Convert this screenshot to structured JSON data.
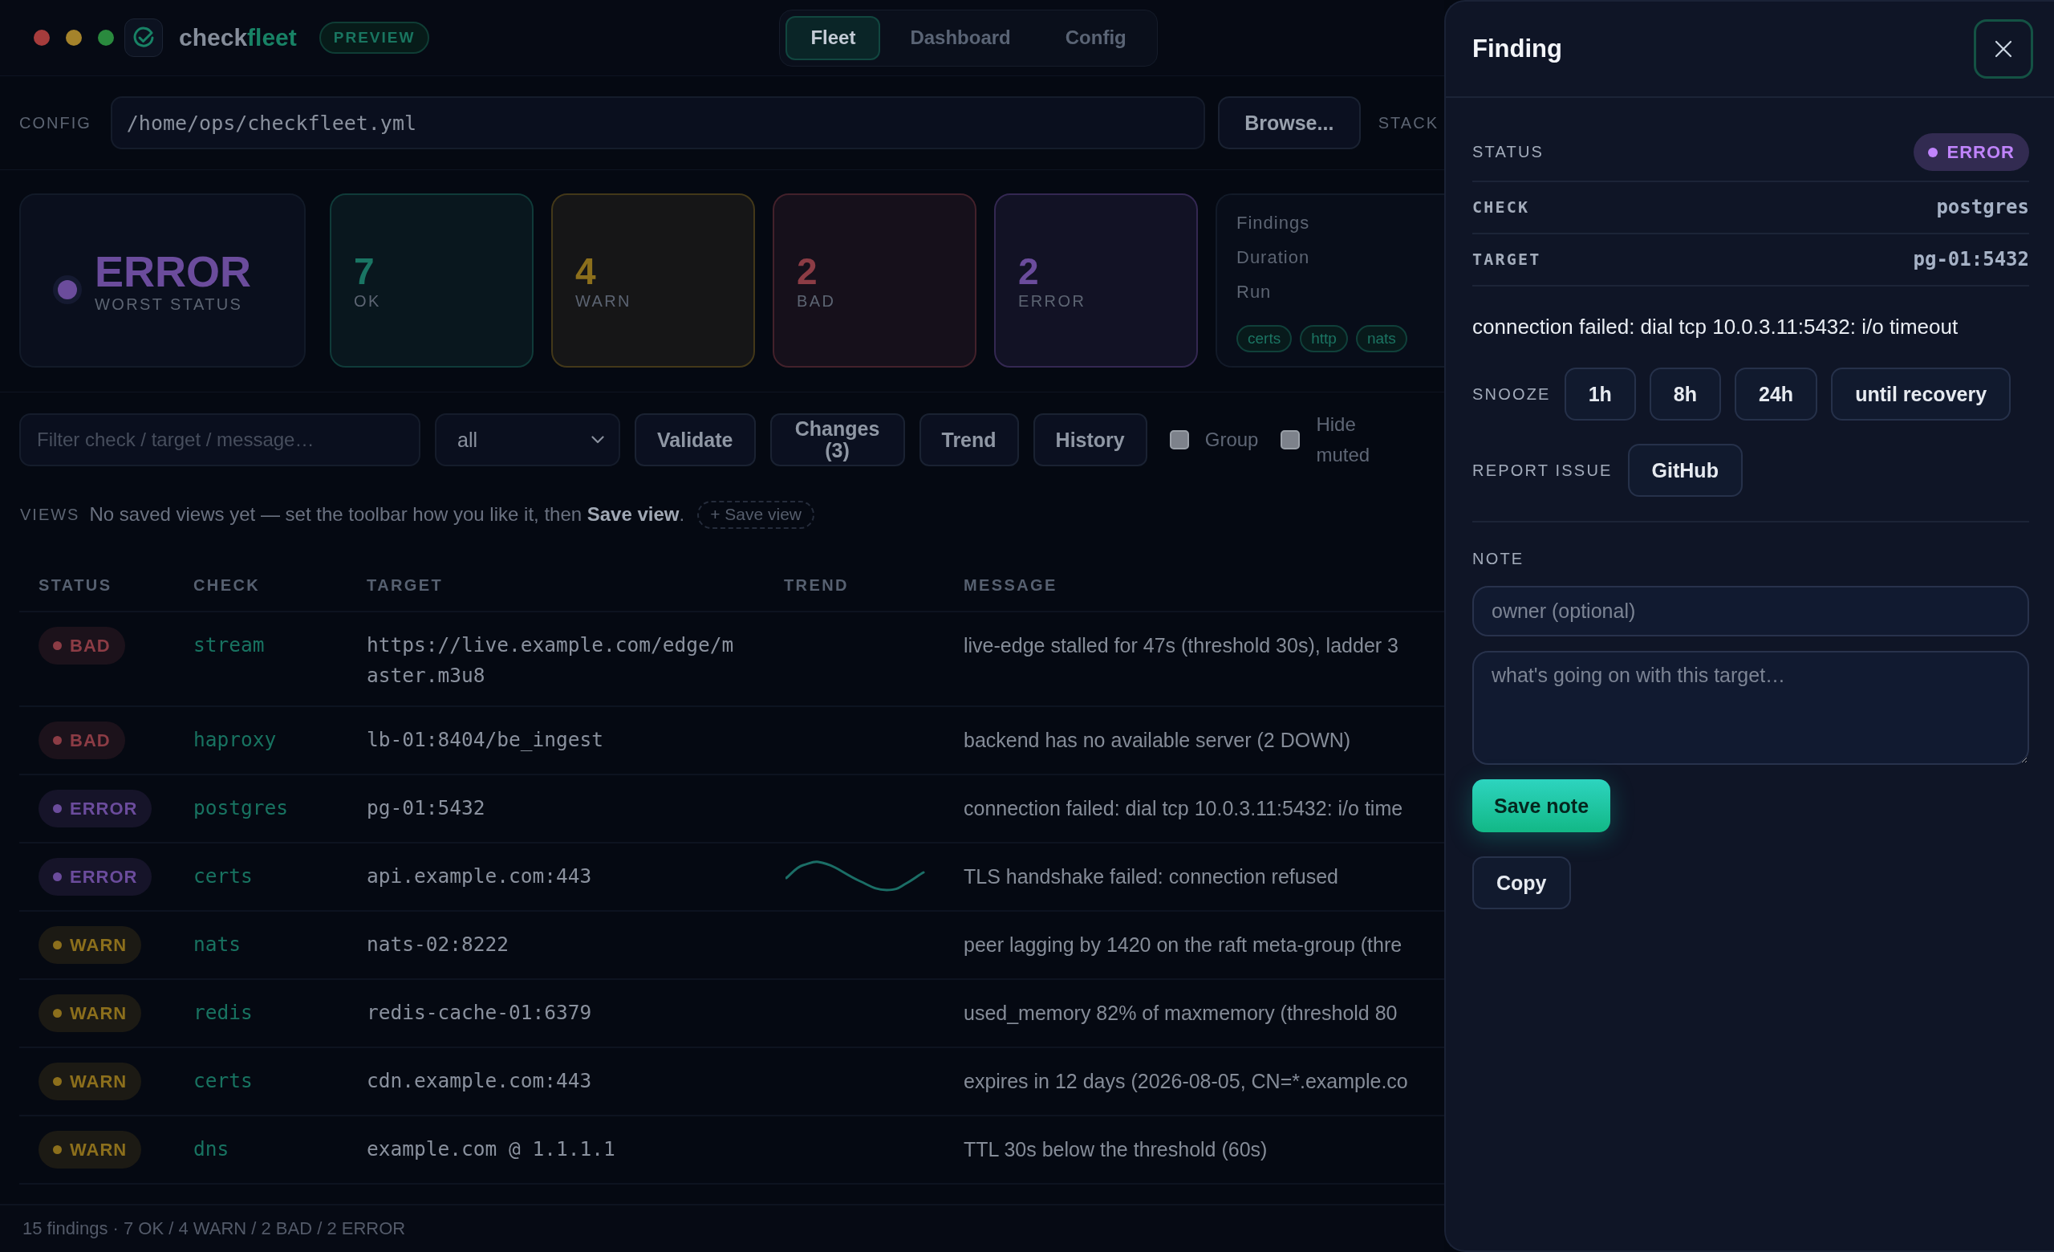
{
  "app": {
    "brand": {
      "name": "check",
      "accent": "fleet"
    },
    "badge": "PREVIEW"
  },
  "tabs": [
    {
      "label": "Fleet",
      "selected": true
    },
    {
      "label": "Dashboard",
      "selected": false
    },
    {
      "label": "Config",
      "selected": false
    }
  ],
  "config": {
    "label": "CONFIG",
    "path": "/home/ops/checkfleet.yml",
    "browse_button": "Browse...",
    "stack_label": "STACK"
  },
  "summary": {
    "worst": {
      "value": "ERROR",
      "label": "WORST STATUS",
      "color": "#6b4c9c"
    },
    "counts": [
      {
        "count": "7",
        "label": "OK",
        "color": "#1a7563"
      },
      {
        "count": "4",
        "label": "WARN",
        "color": "#8c6f1c"
      },
      {
        "count": "2",
        "label": "BAD",
        "color": "#8c3c45"
      },
      {
        "count": "2",
        "label": "ERROR",
        "color": "#6b4c9c"
      }
    ],
    "info": {
      "labels": [
        "Findings",
        "Duration",
        "Run"
      ],
      "tags": [
        "certs",
        "http",
        "nats"
      ]
    }
  },
  "toolbar": {
    "filter": {
      "placeholder": "Filter check / target / message…"
    },
    "status_select": {
      "value": "all"
    },
    "buttons": [
      "Validate",
      "Changes (3)",
      "Trend",
      "History"
    ],
    "checkboxes": [
      {
        "label": "Group",
        "checked": false
      },
      {
        "label": "Hide muted",
        "checked": false
      }
    ]
  },
  "views": {
    "label": "VIEWS",
    "hint": "No saved views yet — set the toolbar how you like it, then **Save view**.",
    "save_button": "+ Save view"
  },
  "table": {
    "columns": [
      "STATUS",
      "CHECK",
      "TARGET",
      "TREND",
      "MESSAGE"
    ],
    "rows": [
      {
        "status": "BAD",
        "color": "#8c3c45",
        "check": "stream",
        "target": "https://live.example.com/edge/master.m3u8",
        "trend": false,
        "message": "live-edge stalled for 47s (threshold 30s), ladder 3"
      },
      {
        "status": "BAD",
        "color": "#8c3c45",
        "check": "haproxy",
        "target": "lb-01:8404/be_ingest",
        "trend": false,
        "message": "backend has no available server (2 DOWN)"
      },
      {
        "status": "ERROR",
        "color": "#6b4c9c",
        "check": "postgres",
        "target": "pg-01:5432",
        "trend": false,
        "message": "connection failed: dial tcp 10.0.3.11:5432: i/o time"
      },
      {
        "status": "ERROR",
        "color": "#6b4c9c",
        "check": "certs",
        "target": "api.example.com:443",
        "trend": true,
        "message": "TLS handshake failed: connection refused"
      },
      {
        "status": "WARN",
        "color": "#8c6f1c",
        "check": "nats",
        "target": "nats-02:8222",
        "trend": false,
        "message": "peer lagging by 1420 on the raft meta-group (thre"
      },
      {
        "status": "WARN",
        "color": "#8c6f1c",
        "check": "redis",
        "target": "redis-cache-01:6379",
        "trend": false,
        "message": "used_memory 82% of maxmemory (threshold 80"
      },
      {
        "status": "WARN",
        "color": "#8c6f1c",
        "check": "certs",
        "target": "cdn.example.com:443",
        "trend": false,
        "message": "expires in 12 days (2026-08-05, CN=*.example.co"
      },
      {
        "status": "WARN",
        "color": "#8c6f1c",
        "check": "dns",
        "target": "example.com @ 1.1.1.1",
        "trend": false,
        "message": "TTL 30s below the threshold (60s)"
      }
    ]
  },
  "status_bar": "15 findings · 7 OK / 4 WARN / 2 BAD / 2 ERROR",
  "drawer": {
    "title": "Finding",
    "fields": [
      {
        "label": "STATUS",
        "kind": "badge",
        "value": "ERROR",
        "color": "#c084fc"
      },
      {
        "label": "CHECK",
        "kind": "code",
        "value": "postgres"
      },
      {
        "label": "TARGET",
        "kind": "code",
        "value": "pg-01:5432"
      }
    ],
    "message": "connection failed: dial tcp 10.0.3.11:5432: i/o timeout",
    "snooze": {
      "label": "SNOOZE",
      "options": [
        "1h",
        "8h",
        "24h",
        "until recovery"
      ]
    },
    "report": {
      "label": "REPORT ISSUE",
      "button": "GitHub"
    },
    "note": {
      "label": "NOTE",
      "owner_placeholder": "owner (optional)",
      "text_placeholder": "what's going on with this target…",
      "save_button": "Save note"
    },
    "copy_button": "Copy"
  }
}
